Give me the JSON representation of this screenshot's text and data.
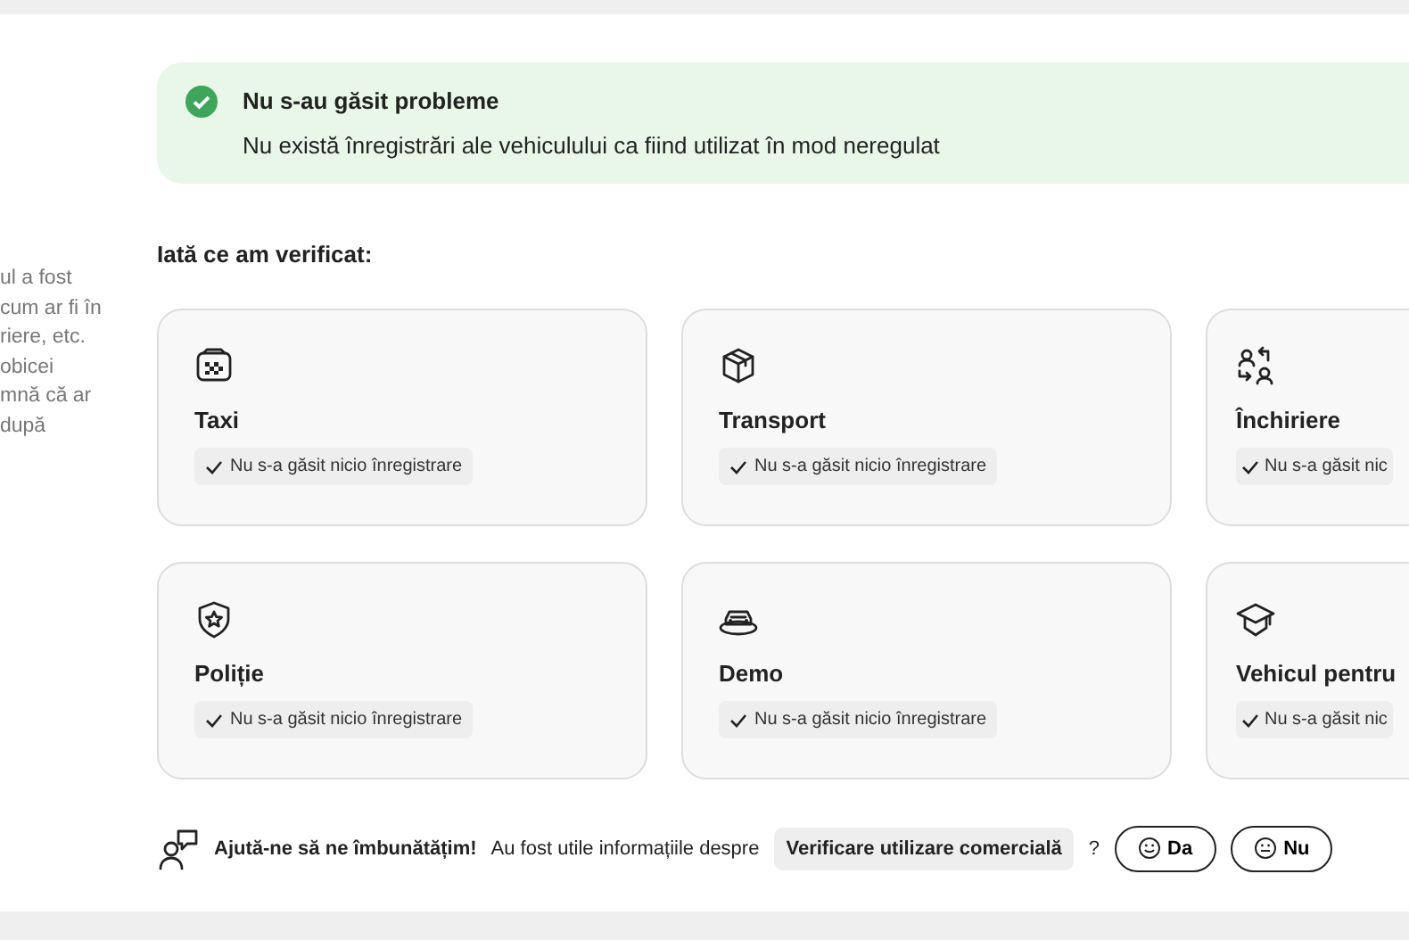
{
  "side_text": [
    "ul a fost",
    "cum ar fi în",
    "riere, etc.",
    "obicei",
    "mnă că ar",
    "după"
  ],
  "alert": {
    "title": "Nu s-au găsit probleme",
    "text": "Nu există înregistrări ale vehiculului ca fiind utilizat în mod neregulat"
  },
  "section_title": "Iată ce am verificat:",
  "checks": [
    {
      "kind": "taxi",
      "title": "Taxi",
      "status": "Nu s-a găsit nicio înregistrare"
    },
    {
      "kind": "box",
      "title": "Transport",
      "status": "Nu s-a găsit nicio înregistrare"
    },
    {
      "kind": "swap",
      "title": "Închiriere",
      "status": "Nu s-a găsit nic"
    },
    {
      "kind": "shield",
      "title": "Poliție",
      "status": "Nu s-a găsit nicio înregistrare"
    },
    {
      "kind": "car",
      "title": "Demo",
      "status": "Nu s-a găsit nicio înregistrare"
    },
    {
      "kind": "cap",
      "title": "Vehicul pentru",
      "status": "Nu s-a găsit nic"
    }
  ],
  "feedback": {
    "title": "Ajută-ne să ne îmbunătățim!",
    "question": "Au fost utile informațiile despre",
    "topic": "Verificare utilizare comercială",
    "mark": "?",
    "buttons": [
      {
        "kind": "smile",
        "label": "Da"
      },
      {
        "kind": "neutral",
        "label": "Nu"
      }
    ]
  }
}
